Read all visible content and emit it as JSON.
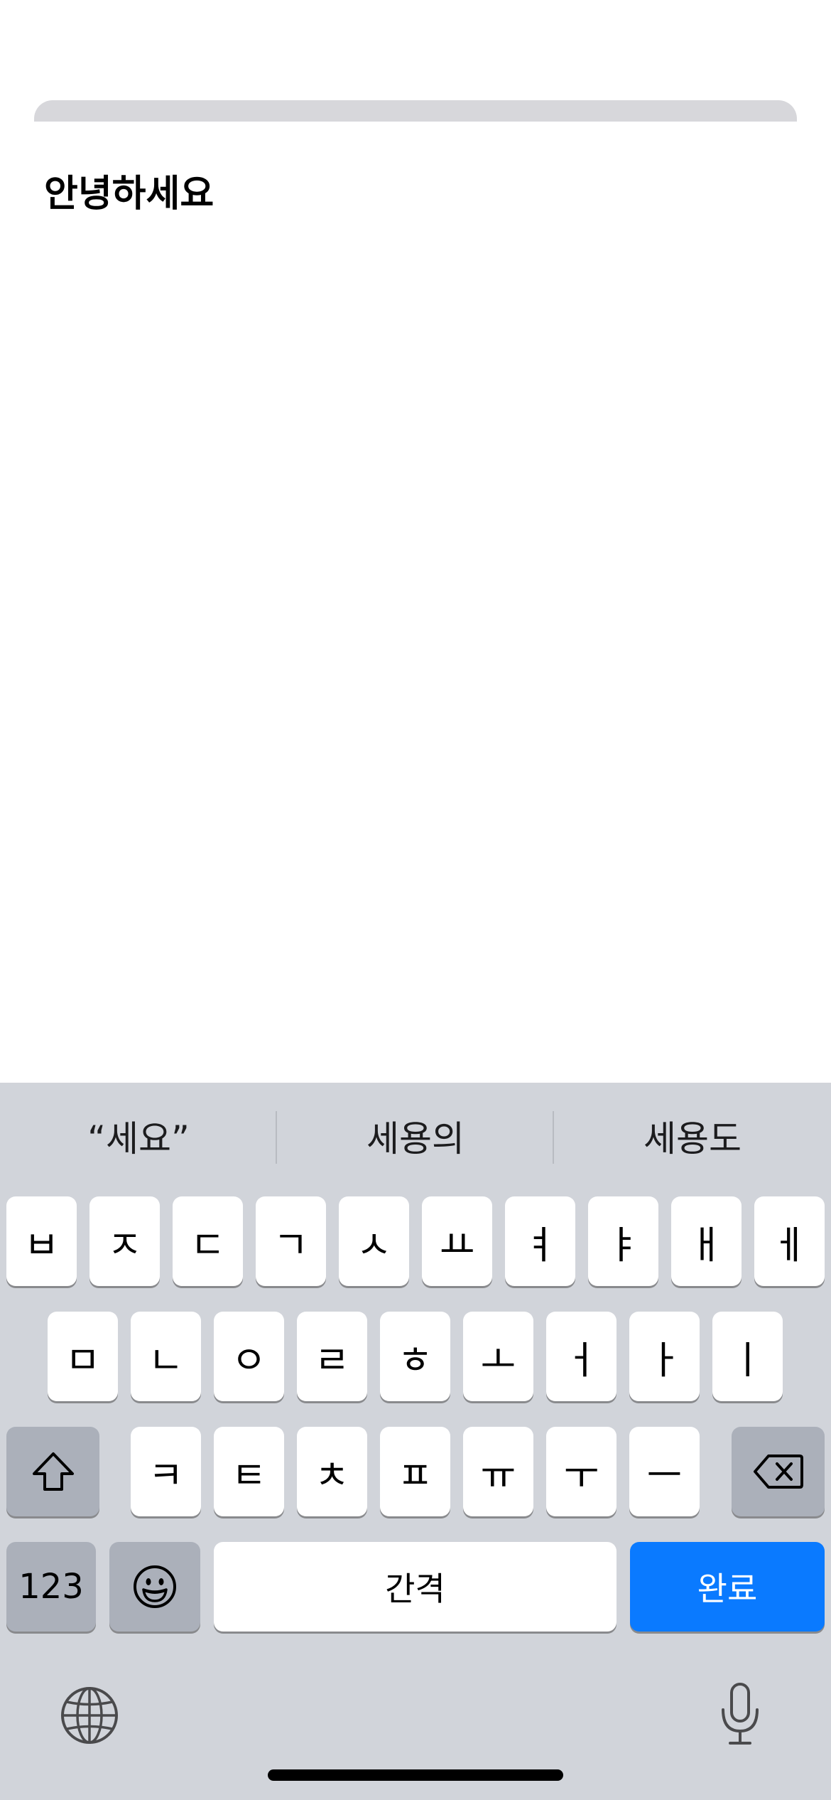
{
  "note": {
    "text": "안녕하세요"
  },
  "predictions": [
    "“세요”",
    "세용의",
    "세용도"
  ],
  "keyboard": {
    "row1": [
      "ㅂ",
      "ㅈ",
      "ㄷ",
      "ㄱ",
      "ㅅ",
      "ㅛ",
      "ㅕ",
      "ㅑ",
      "ㅐ",
      "ㅔ"
    ],
    "row2": [
      "ㅁ",
      "ㄴ",
      "ㅇ",
      "ㄹ",
      "ㅎ",
      "ㅗ",
      "ㅓ",
      "ㅏ",
      "ㅣ"
    ],
    "row3": [
      "ㅋ",
      "ㅌ",
      "ㅊ",
      "ㅍ",
      "ㅠ",
      "ㅜ",
      "ㅡ"
    ],
    "numbers_label": "123",
    "space_label": "간격",
    "done_label": "완료",
    "accent_color": "#0a7aff"
  }
}
